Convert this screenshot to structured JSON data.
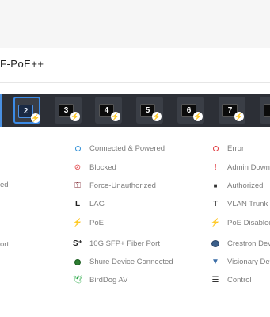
{
  "header": {
    "title": "F-PoE++"
  },
  "ports": [
    {
      "label": "2",
      "selected": true
    },
    {
      "label": "3",
      "selected": false
    },
    {
      "label": "4",
      "selected": false
    },
    {
      "label": "5",
      "selected": false
    },
    {
      "label": "6",
      "selected": false
    },
    {
      "label": "7",
      "selected": false
    }
  ],
  "legend": {
    "col0": [
      "ed",
      "ort"
    ],
    "col1": [
      "Connected & Powered",
      "Blocked",
      "Force-Unauthorized",
      "LAG",
      "PoE",
      "10G SFP+ Fiber Port",
      "Shure Device Connected",
      "BirdDog AV"
    ],
    "col2": [
      "Error",
      "Admin Down",
      "Authorized",
      "VLAN Trunk",
      "PoE Disabled",
      "Crestron Devi",
      "Visionary Dev",
      "Control"
    ]
  },
  "colors": {
    "accent": "#3b8be6",
    "strip": "#2c2f36",
    "poe": "#18a860",
    "error": "#e0393e"
  },
  "glyphs": {
    "lag": "L",
    "vlan": "T",
    "sfp": "S⁺",
    "bolt": "⚡",
    "excl": "!",
    "lock": "🔒",
    "control": "☰"
  }
}
